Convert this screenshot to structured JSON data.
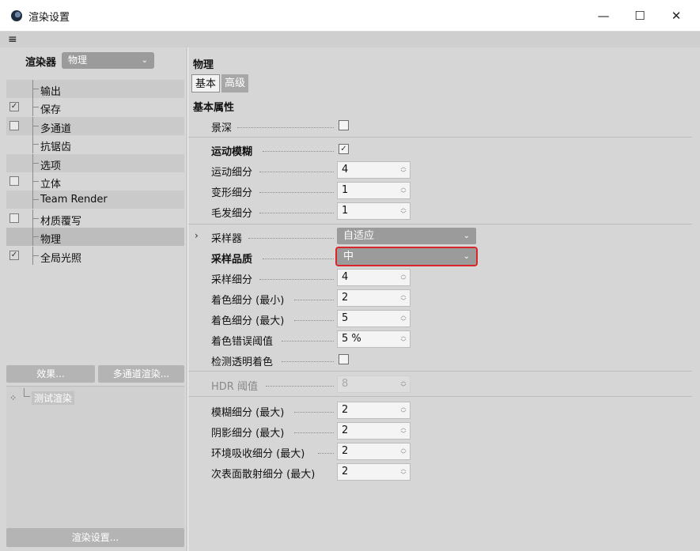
{
  "window": {
    "title": "渲染设置",
    "controls": {
      "minimize": "—",
      "maximize": "☐",
      "close": "✕"
    }
  },
  "menu": {
    "icon": "hamburger-menu-icon",
    "glyph": "≡"
  },
  "left_panel": {
    "renderer_label": "渲染器",
    "renderer_value": "物理",
    "settings_items": [
      {
        "label": "输出",
        "checkbox": null,
        "checked": false
      },
      {
        "label": "保存",
        "checkbox": true,
        "checked": true
      },
      {
        "label": "多通道",
        "checkbox": true,
        "checked": false
      },
      {
        "label": "抗锯齿",
        "checkbox": null,
        "checked": false
      },
      {
        "label": "选项",
        "checkbox": null,
        "checked": false
      },
      {
        "label": "立体",
        "checkbox": true,
        "checked": false
      },
      {
        "label": "Team Render",
        "checkbox": null,
        "checked": false
      },
      {
        "label": "材质覆写",
        "checkbox": true,
        "checked": false
      },
      {
        "label": "物理",
        "checkbox": null,
        "checked": false,
        "selected": true
      },
      {
        "label": "全局光照",
        "checkbox": true,
        "checked": true
      }
    ],
    "effects_button": "效果...",
    "multipass_button": "多通道渲染...",
    "preset_label": "测试渲染",
    "render_settings_button": "渲染设置..."
  },
  "right_panel": {
    "section_title": "物理",
    "tabs": [
      {
        "label": "基本",
        "active": true
      },
      {
        "label": "高级",
        "active": false
      }
    ],
    "props_title": "基本属性",
    "depth_of_field": {
      "label": "景深",
      "checked": false
    },
    "motion_blur": {
      "label": "运动模糊",
      "checked": true
    },
    "motion_subdivision": {
      "label": "运动细分",
      "value": "4"
    },
    "deformation_subdivision": {
      "label": "变形细分",
      "value": "1"
    },
    "hair_subdivision": {
      "label": "毛发细分",
      "value": "1"
    },
    "sampler": {
      "label": "采样器",
      "value": "自适应"
    },
    "sampling_quality": {
      "label": "采样品质",
      "value": "中"
    },
    "sampling_subdivision": {
      "label": "采样细分",
      "value": "4"
    },
    "shading_subdivision_min": {
      "label": "着色细分 (最小)",
      "value": "2"
    },
    "shading_subdivision_max": {
      "label": "着色细分 (最大)",
      "value": "5"
    },
    "shading_error_threshold": {
      "label": "着色错误阈值",
      "value": "5 %"
    },
    "detect_transparent_shading": {
      "label": "检测透明着色",
      "checked": false
    },
    "hdr_threshold": {
      "label": "HDR 阈值",
      "value": "8"
    },
    "blur_subdivision_max": {
      "label": "模糊细分 (最大)",
      "value": "2"
    },
    "shadow_subdivision_max": {
      "label": "阴影细分 (最大)",
      "value": "2"
    },
    "ao_subdivision_max": {
      "label": "环境吸收细分 (最大)",
      "value": "2"
    },
    "sss_subdivision_max": {
      "label": "次表面散射细分 (最大)",
      "value": "2"
    }
  },
  "colors": {
    "panel_bg": "#d6d6d6",
    "dropdown_bg": "#9b9b9b",
    "highlight_outline": "#d8262b"
  }
}
